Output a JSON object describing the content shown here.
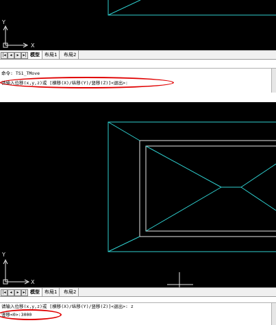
{
  "top_panel": {
    "tabs": [
      {
        "label": "模型",
        "active": true
      },
      {
        "label": "布局1",
        "active": false
      },
      {
        "label": "布局2",
        "active": false
      }
    ],
    "axis": {
      "x_label": "X",
      "y_label": "Y"
    },
    "command_lines": [
      "命令: TS1_TMove",
      "请输入位移(x,y,z)或 [横移(X)/纵移(Y)/竖移(Z)]<退出>:"
    ]
  },
  "bottom_panel": {
    "tabs": [
      {
        "label": "模型",
        "active": true
      },
      {
        "label": "布局1",
        "active": false
      },
      {
        "label": "布局2",
        "active": false
      }
    ],
    "axis": {
      "x_label": "X",
      "y_label": "Y"
    },
    "command_lines": [
      "请输入位移(x,y,z)或 [横移(X)/纵移(Y)/竖移(Z)]<退出>: z",
      "竖移<0>:3000"
    ]
  },
  "colors": {
    "canvas_bg": "#000000",
    "drawing_cyan": "#2fd0d0",
    "drawing_white": "#e8e8e8",
    "highlight_red": "#e00000"
  },
  "icons": [
    "nav-first-icon",
    "nav-prev-icon",
    "nav-next-icon",
    "nav-last-icon",
    "ucs-axis-icon"
  ]
}
